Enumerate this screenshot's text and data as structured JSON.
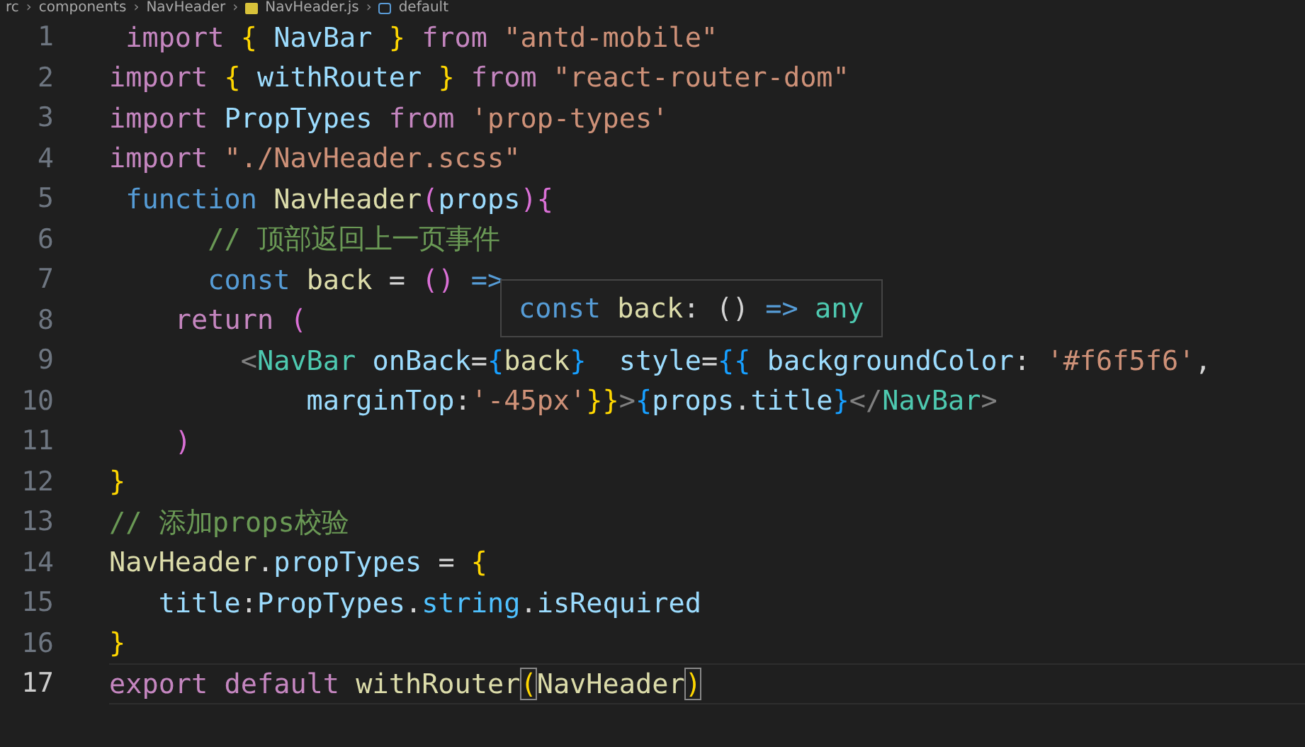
{
  "breadcrumb": [
    {
      "kind": "folder",
      "text": "rc"
    },
    {
      "kind": "folder",
      "text": "components"
    },
    {
      "kind": "folder",
      "text": "NavHeader"
    },
    {
      "kind": "file",
      "text": "NavHeader.js"
    },
    {
      "kind": "symbol",
      "text": "default"
    }
  ],
  "breadcrumb_separator": "›",
  "lines": [
    {
      "number": "1",
      "current": false,
      "tokens": [
        {
          "kind": "keyword",
          "text": " import "
        },
        {
          "kind": "brace",
          "text": "{ "
        },
        {
          "kind": "variable",
          "text": "NavBar "
        },
        {
          "kind": "brace",
          "text": "} "
        },
        {
          "kind": "keyword",
          "text": "from "
        },
        {
          "kind": "string",
          "text": "\"antd-mobile\""
        }
      ]
    },
    {
      "number": "2",
      "current": false,
      "tokens": [
        {
          "kind": "keyword",
          "text": "import "
        },
        {
          "kind": "brace",
          "text": "{ "
        },
        {
          "kind": "variable",
          "text": "withRouter "
        },
        {
          "kind": "brace",
          "text": "} "
        },
        {
          "kind": "keyword",
          "text": "from "
        },
        {
          "kind": "string",
          "text": "\"react-router-dom\""
        }
      ]
    },
    {
      "number": "3",
      "current": false,
      "tokens": [
        {
          "kind": "keyword",
          "text": "import "
        },
        {
          "kind": "variable",
          "text": "PropTypes "
        },
        {
          "kind": "keyword",
          "text": "from "
        },
        {
          "kind": "string",
          "text": "'prop-types'"
        }
      ]
    },
    {
      "number": "4",
      "current": false,
      "tokens": [
        {
          "kind": "keyword",
          "text": "import "
        },
        {
          "kind": "string",
          "text": "\"./NavHeader.scss\""
        }
      ]
    },
    {
      "number": "5",
      "current": false,
      "tokens": [
        {
          "kind": "storage",
          "text": " function "
        },
        {
          "kind": "function",
          "text": "NavHeader"
        },
        {
          "kind": "paren",
          "text": "("
        },
        {
          "kind": "variable",
          "text": "props"
        },
        {
          "kind": "paren",
          "text": "){"
        }
      ]
    },
    {
      "number": "6",
      "current": false,
      "tokens": [
        {
          "kind": "comment",
          "text": "      // 顶部返回上一页事件"
        }
      ]
    },
    {
      "number": "7",
      "current": false,
      "tokens": [
        {
          "kind": "storage",
          "text": "      const "
        },
        {
          "kind": "function",
          "text": "back "
        },
        {
          "kind": "plain",
          "text": "= "
        },
        {
          "kind": "paren",
          "text": "() "
        },
        {
          "kind": "storage",
          "text": "=>"
        }
      ]
    },
    {
      "number": "8",
      "current": false,
      "tokens": [
        {
          "kind": "keyword",
          "text": "    return "
        },
        {
          "kind": "paren",
          "text": "("
        }
      ]
    },
    {
      "number": "9",
      "current": false,
      "tokens": [
        {
          "kind": "tag-punct",
          "text": "        <"
        },
        {
          "kind": "tag",
          "text": "NavBar "
        },
        {
          "kind": "variable",
          "text": "onBack"
        },
        {
          "kind": "plain",
          "text": "="
        },
        {
          "kind": "brace3",
          "text": "{"
        },
        {
          "kind": "function",
          "text": "back"
        },
        {
          "kind": "brace3",
          "text": "}  "
        },
        {
          "kind": "variable",
          "text": "style"
        },
        {
          "kind": "plain",
          "text": "="
        },
        {
          "kind": "brace3",
          "text": "{{ "
        },
        {
          "kind": "variable",
          "text": "backgroundColor"
        },
        {
          "kind": "plain",
          "text": ": "
        },
        {
          "kind": "string",
          "text": "'#f6f5f6'"
        },
        {
          "kind": "plain",
          "text": ","
        }
      ]
    },
    {
      "number": "10",
      "current": false,
      "tokens": [
        {
          "kind": "variable",
          "text": "            marginTop"
        },
        {
          "kind": "plain",
          "text": ":"
        },
        {
          "kind": "string",
          "text": "'-45px'"
        },
        {
          "kind": "brace",
          "text": "}}"
        },
        {
          "kind": "tag-punct",
          "text": ">"
        },
        {
          "kind": "brace3",
          "text": "{"
        },
        {
          "kind": "variable",
          "text": "props"
        },
        {
          "kind": "plain",
          "text": "."
        },
        {
          "kind": "variable",
          "text": "title"
        },
        {
          "kind": "brace3",
          "text": "}"
        },
        {
          "kind": "tag-punct",
          "text": "</"
        },
        {
          "kind": "tag",
          "text": "NavBar"
        },
        {
          "kind": "tag-punct",
          "text": ">"
        }
      ]
    },
    {
      "number": "11",
      "current": false,
      "tokens": [
        {
          "kind": "paren",
          "text": "    )"
        }
      ]
    },
    {
      "number": "12",
      "current": false,
      "tokens": [
        {
          "kind": "brace",
          "text": "}"
        }
      ]
    },
    {
      "number": "13",
      "current": false,
      "tokens": [
        {
          "kind": "comment",
          "text": "// 添加props校验"
        }
      ]
    },
    {
      "number": "14",
      "current": false,
      "tokens": [
        {
          "kind": "function",
          "text": "NavHeader"
        },
        {
          "kind": "plain",
          "text": "."
        },
        {
          "kind": "variable",
          "text": "propTypes "
        },
        {
          "kind": "plain",
          "text": "= "
        },
        {
          "kind": "brace",
          "text": "{"
        }
      ]
    },
    {
      "number": "15",
      "current": false,
      "tokens": [
        {
          "kind": "variable",
          "text": "   title"
        },
        {
          "kind": "plain",
          "text": ":"
        },
        {
          "kind": "variable",
          "text": "PropTypes"
        },
        {
          "kind": "plain",
          "text": "."
        },
        {
          "kind": "constant",
          "text": "string"
        },
        {
          "kind": "plain",
          "text": "."
        },
        {
          "kind": "variable",
          "text": "isRequired"
        }
      ]
    },
    {
      "number": "16",
      "current": false,
      "tokens": [
        {
          "kind": "brace",
          "text": "}"
        }
      ]
    },
    {
      "number": "17",
      "current": true,
      "tokens": [
        {
          "kind": "keyword",
          "text": "export "
        },
        {
          "kind": "keyword",
          "text": "default "
        },
        {
          "kind": "function",
          "text": "withRouter"
        },
        {
          "kind": "paren-match",
          "text": "("
        },
        {
          "kind": "function",
          "text": "NavHeader"
        },
        {
          "kind": "paren-match",
          "text": ")"
        }
      ]
    }
  ],
  "tooltip": {
    "tokens": [
      {
        "kind": "storage",
        "text": "const "
      },
      {
        "kind": "function",
        "text": "back"
      },
      {
        "kind": "plain",
        "text": ": "
      },
      {
        "kind": "plain",
        "text": "() "
      },
      {
        "kind": "storage",
        "text": "=> "
      },
      {
        "kind": "type",
        "text": "any"
      }
    ]
  }
}
